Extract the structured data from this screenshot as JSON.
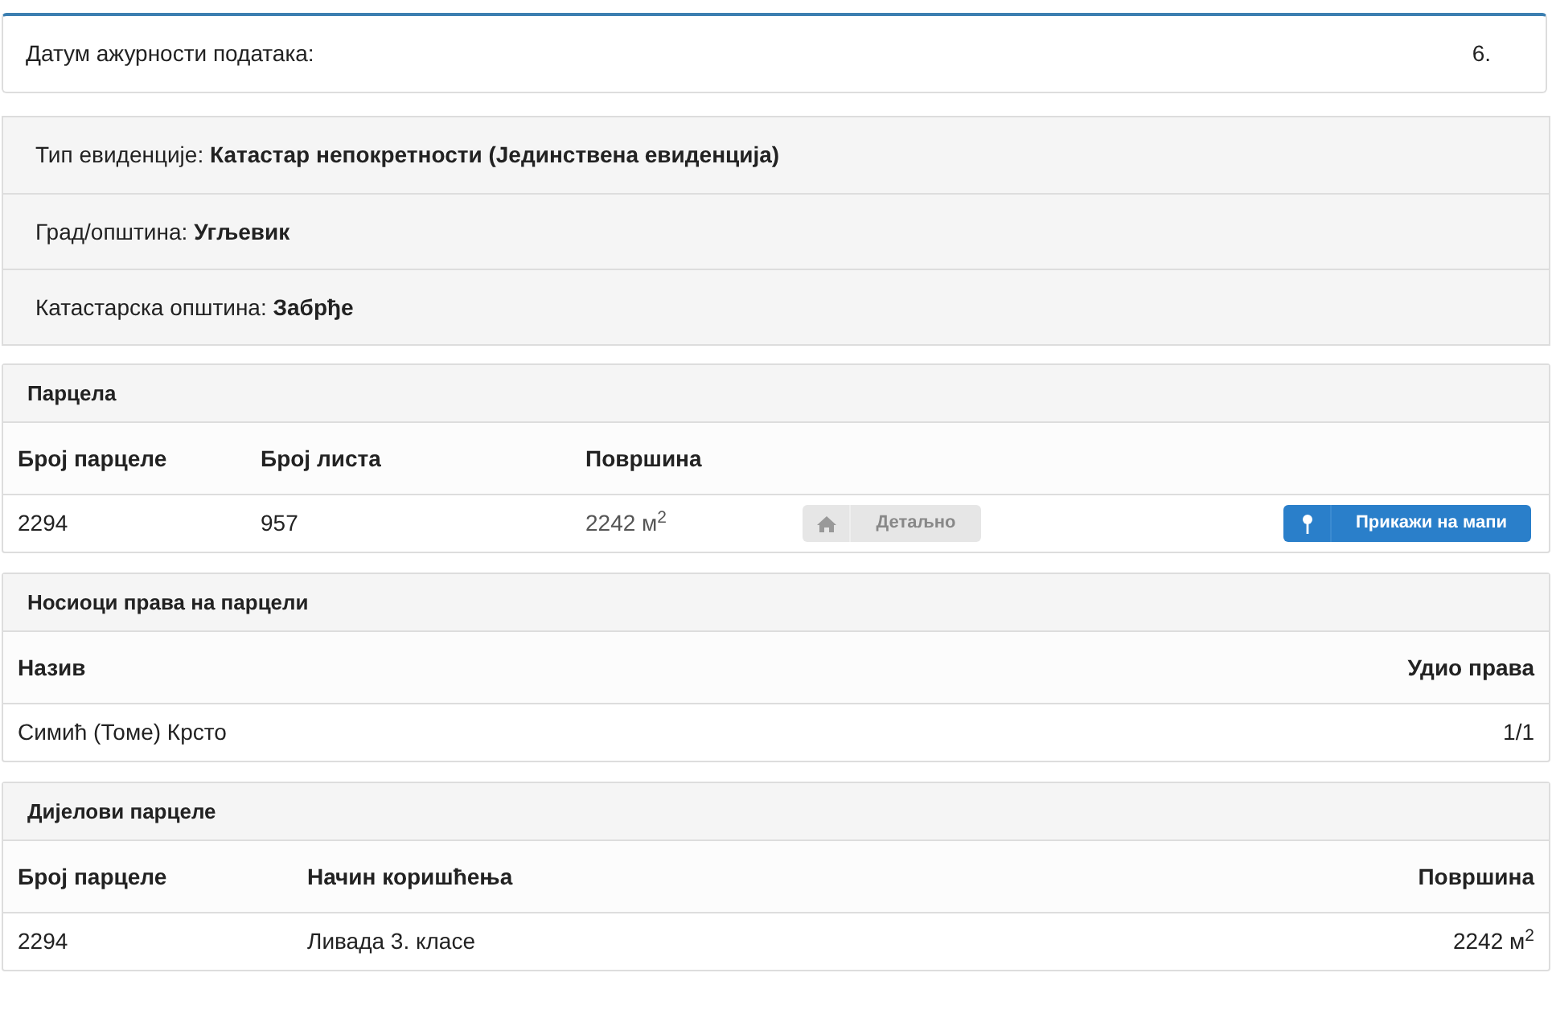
{
  "update": {
    "label": "Датум ажурности података:",
    "value": "6."
  },
  "info": [
    {
      "label": "Тип евиденције:",
      "value": "Катастар непокретности (Јединствена евиденција)"
    },
    {
      "label": "Град/општина:",
      "value": "Угљевик"
    },
    {
      "label": "Катастарска општина:",
      "value": "Забрђе"
    }
  ],
  "sections": [
    {
      "title": "Парцела",
      "kind": "parcel",
      "columns": [
        "Број парцеле",
        "Број листа",
        "Површина"
      ],
      "rows": [
        {
          "cells": [
            "2294",
            "957",
            "2242 м$^{2}$"
          ],
          "buttons": [
            {
              "label": "Детаљно",
              "kind": "detail",
              "disabled": true
            },
            {
              "label": "Прикажи на мапи",
              "kind": "map",
              "disabled": false
            }
          ]
        }
      ]
    },
    {
      "title": "Носиоци права на парцели",
      "kind": "owners",
      "columns": [
        "Назив",
        "Удио права"
      ],
      "rows": [
        {
          "cells": [
            "Симић (Томе) Крсто",
            "1/1"
          ]
        }
      ]
    },
    {
      "title": "Дијелови парцеле",
      "kind": "parts",
      "columns": [
        "Број парцеле",
        "Начин коришћења",
        "Површина"
      ],
      "rows": [
        {
          "cells": [
            "2294",
            "Ливада 3. класе",
            "2242 м$^{2}$"
          ]
        }
      ]
    }
  ]
}
